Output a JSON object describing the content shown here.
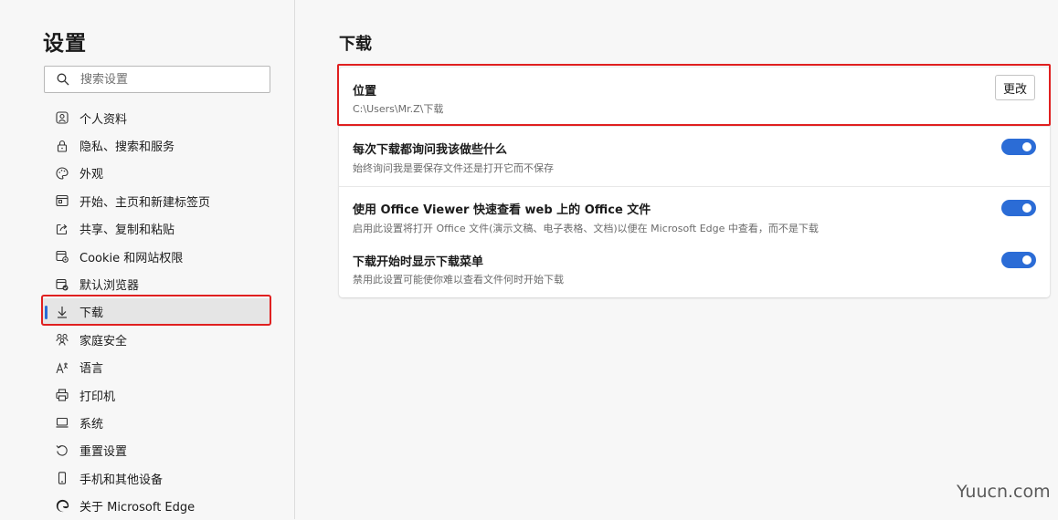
{
  "sidebar": {
    "title": "设置",
    "search": {
      "placeholder": "搜索设置",
      "value": ""
    },
    "items": [
      {
        "label": "个人资料",
        "icon": "profile-icon"
      },
      {
        "label": "隐私、搜索和服务",
        "icon": "lock-icon"
      },
      {
        "label": "外观",
        "icon": "palette-icon"
      },
      {
        "label": "开始、主页和新建标签页",
        "icon": "home-tab-icon"
      },
      {
        "label": "共享、复制和粘贴",
        "icon": "share-icon"
      },
      {
        "label": "Cookie 和网站权限",
        "icon": "site-permissions-icon"
      },
      {
        "label": "默认浏览器",
        "icon": "default-browser-icon"
      },
      {
        "label": "下载",
        "icon": "download-icon",
        "active": true
      },
      {
        "label": "家庭安全",
        "icon": "family-icon"
      },
      {
        "label": "语言",
        "icon": "language-icon"
      },
      {
        "label": "打印机",
        "icon": "printer-icon"
      },
      {
        "label": "系统",
        "icon": "system-icon"
      },
      {
        "label": "重置设置",
        "icon": "reset-icon"
      },
      {
        "label": "手机和其他设备",
        "icon": "phone-icon"
      },
      {
        "label": "关于 Microsoft Edge",
        "icon": "edge-logo-icon"
      }
    ]
  },
  "main": {
    "title": "下载",
    "location": {
      "label": "位置",
      "path": "C:\\Users\\Mr.Z\\下载",
      "change_label": "更改"
    },
    "settings": [
      {
        "label": "每次下载都询问我该做些什么",
        "desc": "始终询问我是要保存文件还是打开它而不保存",
        "enabled": true
      },
      {
        "label": "使用 Office Viewer 快速查看 web 上的 Office 文件",
        "desc": "启用此设置将打开 Office 文件(演示文稿、电子表格、文档)以便在 Microsoft Edge 中查看，而不是下载",
        "enabled": true
      },
      {
        "label": "下载开始时显示下载菜单",
        "desc": "禁用此设置可能使你难以查看文件何时开始下载",
        "enabled": true
      }
    ]
  },
  "watermark": "Yuucn.com",
  "colors": {
    "accent": "#2b6cd6",
    "highlight": "#e02020"
  }
}
